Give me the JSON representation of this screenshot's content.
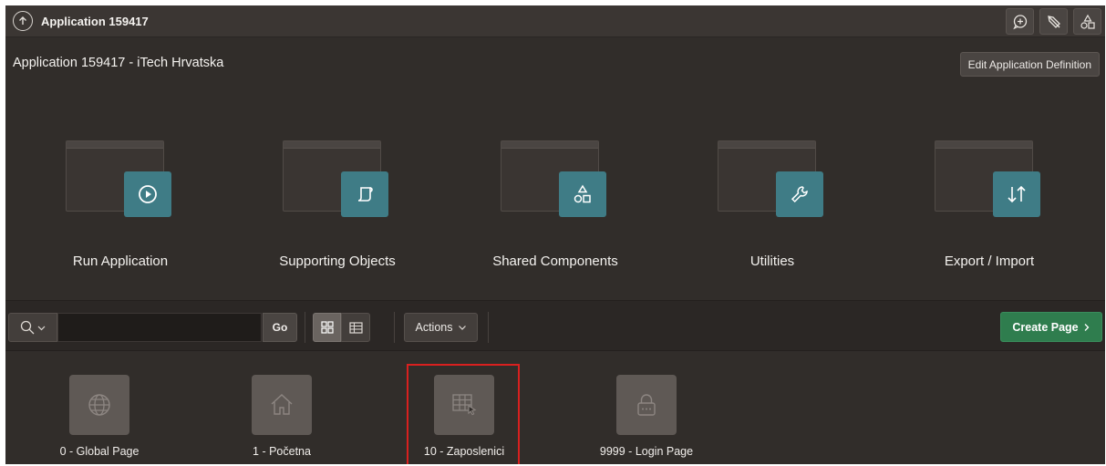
{
  "topbar": {
    "app_title": "Application 159417",
    "icons": [
      "up-arrow-icon",
      "feedback-icon",
      "edit-icon",
      "shared-components-icon"
    ]
  },
  "header": {
    "title": "Application 159417 - iTech Hrvatska",
    "edit_button": "Edit Application Definition"
  },
  "tiles": [
    {
      "label": "Run Application",
      "icon": "play-icon"
    },
    {
      "label": "Supporting Objects",
      "icon": "scroll-icon"
    },
    {
      "label": "Shared Components",
      "icon": "shapes-icon"
    },
    {
      "label": "Utilities",
      "icon": "wrench-icon"
    },
    {
      "label": "Export / Import",
      "icon": "up-down-arrows-icon"
    }
  ],
  "toolbar": {
    "search_value": "",
    "go_label": "Go",
    "actions_label": "Actions",
    "create_label": "Create Page",
    "active_view": "grid"
  },
  "pages": [
    {
      "label": "0 - Global Page",
      "icon": "globe-icon"
    },
    {
      "label": "1 - Početna",
      "icon": "home-icon"
    },
    {
      "label": "10 - Zaposlenici",
      "icon": "grid-cursor-icon",
      "highlighted": true
    },
    {
      "label": "9999 - Login Page",
      "icon": "lock-icon"
    }
  ],
  "colors": {
    "background": "#312d2a",
    "topbar": "#3b3633",
    "tile_badge": "#3f7c86",
    "create_button": "#2f7d4e",
    "highlight": "#d9201f"
  }
}
